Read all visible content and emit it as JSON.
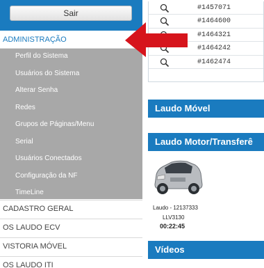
{
  "sidebar": {
    "logout_label": "Sair",
    "admin_header": "ADMINISTRAÇÃO",
    "admin_items": [
      "Perfil do Sistema",
      "Usuários do Sistema",
      "Alterar Senha",
      "Redes",
      "Grupos de Páginas/Menu",
      "Serial",
      "Usuários Conectados",
      "Configuração da NF",
      "TimeLine"
    ],
    "categories": [
      "CADASTRO GERAL",
      "OS LAUDO ECV",
      "VISTORIA MÓVEL",
      "OS LAUDO ITI"
    ]
  },
  "table": {
    "rows": [
      "#1457071",
      "#1464600",
      "#1464321",
      "#1464242",
      "#1462474"
    ]
  },
  "sections": {
    "laudo_movel": "Laudo Móvel",
    "laudo_motor": "Laudo Motor/Transferê",
    "videos": "Vídeos"
  },
  "card": {
    "laudo": "Laudo - 12137333",
    "placa": "LLV3130",
    "tempo": "00:22:45"
  },
  "colors": {
    "accent": "#1a7bbf",
    "submenu_bg": "#a8a8a8",
    "arrow": "#d6141c"
  },
  "icons": {
    "row_action": "search-icon",
    "annotation": "arrow-left-icon"
  }
}
